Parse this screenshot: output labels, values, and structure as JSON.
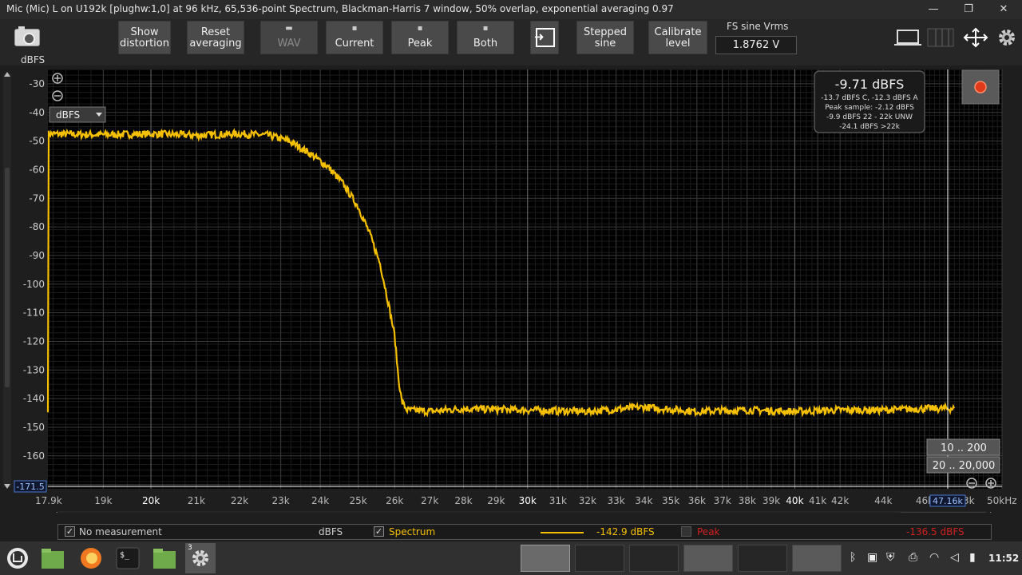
{
  "window": {
    "title": "Mic (Mic) L on U192k [plughw:1,0] at 96 kHz, 65,536-point Spectrum, Blackman-Harris 7 window, 50% overlap, exponential averaging 0.97",
    "minimize": "—",
    "restore": "❐",
    "close": "✕"
  },
  "toolbar": {
    "y_unit_label": "dBFS",
    "show_distortion": [
      "Show",
      "distortion"
    ],
    "reset_averaging": [
      "Reset",
      "averaging"
    ],
    "wav": "WAV",
    "current": "Current",
    "peak": "Peak",
    "both": "Both",
    "stepped_sine": [
      "Stepped",
      "sine"
    ],
    "calibrate_level": [
      "Calibrate",
      "level"
    ],
    "fs_sine_label": "FS sine Vrms",
    "fs_sine_value": "1.8762 V"
  },
  "chart_data": {
    "type": "line",
    "ylabel": "dBFS",
    "xlabel": "kHz",
    "x_scale": "log",
    "xlim": [
      17.9,
      50
    ],
    "ylim": [
      -171.5,
      -25
    ],
    "y_ticks": [
      -30,
      -40,
      -50,
      -60,
      -70,
      -80,
      -90,
      -100,
      -110,
      -120,
      -130,
      -140,
      -150,
      -160,
      -170
    ],
    "y_tick_labels": [
      "-30",
      "-40",
      "-50",
      "-60",
      "-70",
      "-80",
      "-90",
      "-100",
      "-110",
      "-120",
      "-130",
      "-140",
      "-150",
      "-160",
      "-170"
    ],
    "x_ticks": [
      17.9,
      19,
      20,
      21,
      22,
      23,
      24,
      25,
      26,
      27,
      28,
      29,
      30,
      31,
      32,
      33,
      34,
      35,
      36,
      37,
      38,
      39,
      40,
      41,
      42,
      44,
      46,
      50
    ],
    "x_tick_labels": [
      "17.9k",
      "19k",
      "20k",
      "21k",
      "22k",
      "23k",
      "24k",
      "25k",
      "26k",
      "27k",
      "28k",
      "29k",
      "30k",
      "31k",
      "32k",
      "33k",
      "34k",
      "35k",
      "36k",
      "37k",
      "38k",
      "39k",
      "40k",
      "41k",
      "42k",
      "44k",
      "46k",
      "50kHz"
    ],
    "x_tick_bold": [
      false,
      false,
      true,
      false,
      false,
      false,
      false,
      false,
      false,
      false,
      false,
      false,
      true,
      false,
      false,
      false,
      false,
      false,
      false,
      false,
      false,
      false,
      true,
      false,
      false,
      false,
      false,
      false
    ],
    "grid": true,
    "series": [
      {
        "name": "Spectrum",
        "color": "#f5c000",
        "x": [
          17.9,
          19,
          20,
          21,
          22,
          22.7,
          23.2,
          23.7,
          24.2,
          24.6,
          25.0,
          25.3,
          25.6,
          25.8,
          26.0,
          26.1,
          26.2,
          26.35,
          27,
          28,
          30,
          32,
          34,
          36,
          38,
          40,
          42,
          44,
          46,
          47.5
        ],
        "y": [
          -47.5,
          -47.8,
          -47.5,
          -48,
          -47.5,
          -48,
          -50,
          -54,
          -59,
          -65,
          -73,
          -82,
          -93,
          -105,
          -118,
          -132,
          -141,
          -144,
          -144.5,
          -143.5,
          -144,
          -144.5,
          -143,
          -144.5,
          -144,
          -144.5,
          -144,
          -144,
          -143.5,
          -143.5
        ]
      }
    ],
    "cursor": {
      "x": 47.16,
      "x_label": "47.16k",
      "y_label": "-171.5",
      "color": "#ffffff"
    },
    "x_end_label_fragment": "3k"
  },
  "level_box": {
    "main": "-9.71 dBFS",
    "lines": [
      "-13.7 dBFS C, -12.3 dBFS A",
      "Peak sample: -2.12 dBFS",
      "-9.9 dBFS 22 - 22k UNW",
      "-24.1 dBFS >22k"
    ]
  },
  "plot_controls": {
    "unit_dropdown": "dBFS",
    "zoom_in": "⊕",
    "zoom_out": "⊖",
    "range_1": "10 .. 200",
    "range_2": "20 .. 20,000"
  },
  "legend": {
    "no_measurement": "No measurement",
    "no_measurement_unit": "dBFS",
    "spectrum_label": "Spectrum",
    "spectrum_value": "-142.9 dBFS",
    "spectrum_color": "#f5c000",
    "peak_label": "Peak",
    "peak_value": "-136.5 dBFS",
    "peak_color": "#d02020"
  },
  "taskbar": {
    "badge_count": "3",
    "clock": "11:52"
  }
}
